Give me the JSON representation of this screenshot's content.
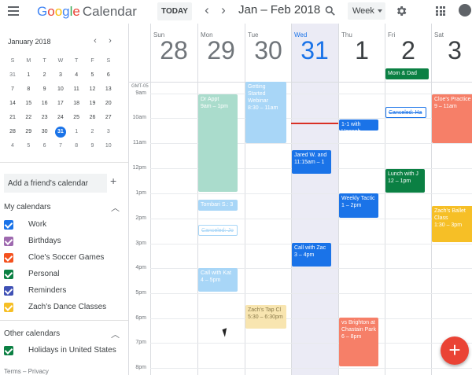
{
  "header": {
    "logo_google": [
      "G",
      "o",
      "o",
      "g",
      "l",
      "e"
    ],
    "logo_calendar": "Calendar",
    "today_label": "TODAY",
    "prev_label": "‹",
    "next_label": "›",
    "range_title": "Jan – Feb 2018",
    "view_label": "Week"
  },
  "mini_calendar": {
    "month_label": "January 2018",
    "prev": "‹",
    "next": "›",
    "weekdays": [
      "S",
      "M",
      "T",
      "W",
      "T",
      "F",
      "S"
    ],
    "weeks": [
      [
        "31",
        "1",
        "2",
        "3",
        "4",
        "5",
        "6"
      ],
      [
        "7",
        "8",
        "9",
        "10",
        "11",
        "12",
        "13"
      ],
      [
        "14",
        "15",
        "16",
        "17",
        "18",
        "19",
        "20"
      ],
      [
        "21",
        "22",
        "23",
        "24",
        "25",
        "26",
        "27"
      ],
      [
        "28",
        "29",
        "30",
        "31",
        "1",
        "2",
        "3"
      ],
      [
        "4",
        "5",
        "6",
        "7",
        "8",
        "9",
        "10"
      ]
    ],
    "today": "31"
  },
  "sidebar": {
    "add_friend_placeholder": "Add a friend's calendar",
    "add_plus": "+",
    "my_calendars_title": "My calendars",
    "my_calendars": [
      {
        "name": "Work",
        "color": "#1a73e8"
      },
      {
        "name": "Birthdays",
        "color": "#9e69af"
      },
      {
        "name": "Cloe's Soccer Games",
        "color": "#f4511e"
      },
      {
        "name": "Personal",
        "color": "#0b8043"
      },
      {
        "name": "Reminders",
        "color": "#3f51b5"
      },
      {
        "name": "Zach's Dance Classes",
        "color": "#f6bf26"
      }
    ],
    "other_calendars_title": "Other calendars",
    "other_calendars": [
      {
        "name": "Holidays in United States",
        "color": "#0b8043"
      }
    ],
    "footer": "Terms – Privacy"
  },
  "week": {
    "timezone": "GMT-05",
    "days": [
      {
        "name": "Sun",
        "date": "28"
      },
      {
        "name": "Mon",
        "date": "29"
      },
      {
        "name": "Tue",
        "date": "30"
      },
      {
        "name": "Wed",
        "date": "31"
      },
      {
        "name": "Thu",
        "date": "1"
      },
      {
        "name": "Fri",
        "date": "2"
      },
      {
        "name": "Sat",
        "date": "3"
      }
    ],
    "hours": [
      "9am",
      "10am",
      "11am",
      "12pm",
      "1pm",
      "2pm",
      "3pm",
      "4pm",
      "5pm",
      "6pm",
      "7pm",
      "8pm"
    ]
  },
  "events": [
    {
      "day": 5,
      "allday": true,
      "title": "Mom & Dad",
      "time": "",
      "color": "#0b8043"
    },
    {
      "day": 1,
      "title": "Dr Appt",
      "time": "9am – 1pm",
      "color": "#aadccc"
    },
    {
      "day": 2,
      "title": "Getting Started Webinar",
      "time": "8:30 – 11am",
      "color": "#a8d6f7"
    },
    {
      "day": 4,
      "title": "1-1 with Hannah",
      "time": "",
      "color": "#1a73e8"
    },
    {
      "day": 5,
      "title": "Canceled: Ha",
      "time": "",
      "color": "#1a73e8",
      "outline": true
    },
    {
      "day": 6,
      "title": "Cloe's Practice",
      "time": "9 – 11am",
      "color": "#f67f68"
    },
    {
      "day": 3,
      "title": "Jared W. and",
      "time": "11:15am – 1",
      "color": "#1a73e8"
    },
    {
      "day": 5,
      "title": "Lunch with J",
      "time": "12 – 1pm",
      "color": "#0b8043"
    },
    {
      "day": 1,
      "title": "Tombari S.: 3",
      "time": "",
      "color": "#a8d6f7"
    },
    {
      "day": 4,
      "title": "Weekly Tactic",
      "time": "1 – 2pm",
      "color": "#1a73e8"
    },
    {
      "day": 6,
      "title": "Zach's Ballet Class",
      "time": "1:30 – 3pm",
      "color": "#f6bf26"
    },
    {
      "day": 1,
      "title": "Canceled: Jo",
      "time": "",
      "color": "#a8d6f7",
      "outline": true
    },
    {
      "day": 3,
      "title": "Call with Zac",
      "time": "3 – 4pm",
      "color": "#1a73e8"
    },
    {
      "day": 1,
      "title": "Call with Kat",
      "time": "4 – 5pm",
      "color": "#a8d6f7"
    },
    {
      "day": 2,
      "title": "Zach's Tap Cl",
      "time": "5:30 – 6:30pm",
      "color": "#f8e5b0"
    },
    {
      "day": 4,
      "title": "vs Brighton at Chastain Park",
      "time": "6 – 8pm",
      "color": "#f67f68"
    }
  ],
  "fab_label": "+"
}
